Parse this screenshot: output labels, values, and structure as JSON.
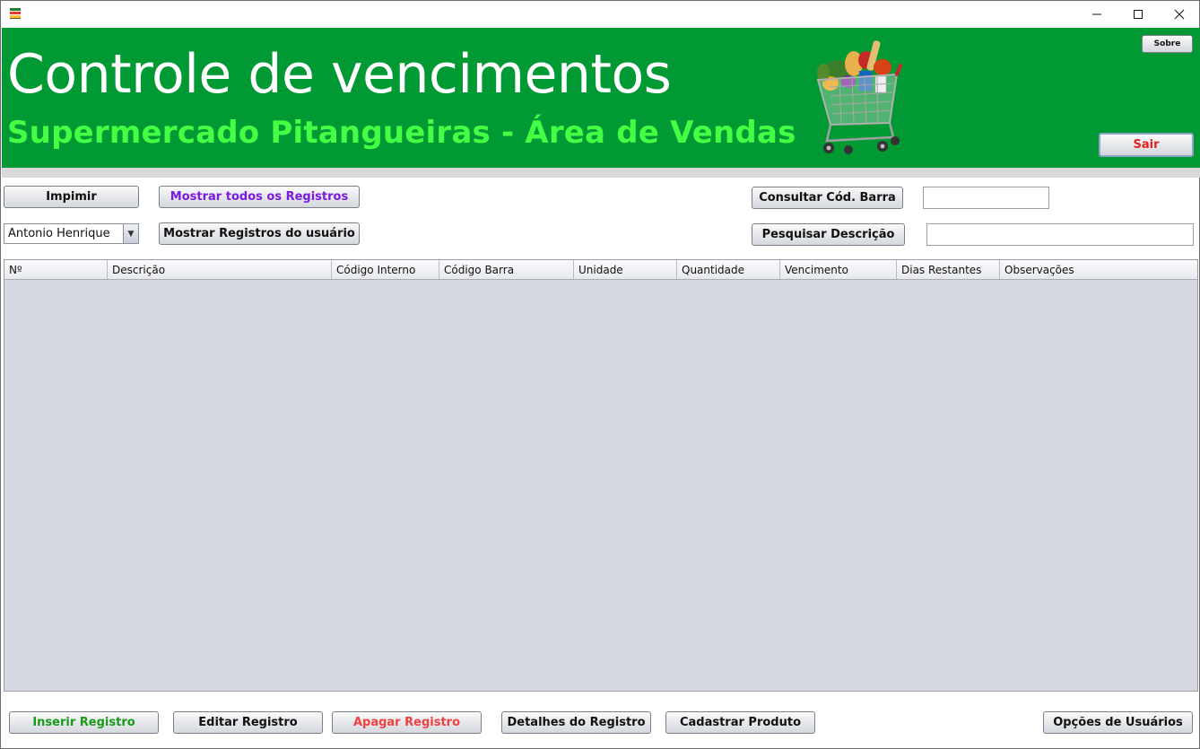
{
  "window": {
    "controls": {
      "minimize": "—",
      "maximize": "☐",
      "close": "✕"
    }
  },
  "banner": {
    "title": "Controle de vencimentos",
    "subtitle": "Supermercado Pitangueiras - Área de Vendas",
    "background": "#009933",
    "subtitle_color": "#44ff44",
    "sobre_label": "Sobre",
    "sair_label": "Sair"
  },
  "toolbar": {
    "imprimir_label": "Impimir",
    "mostrar_todos_label": "Mostrar todos os Registros",
    "mostrar_usuario_label": "Mostrar Registros do usuário",
    "consultar_label": "Consultar Cód. Barra",
    "pesquisar_label": "Pesquisar Descrição",
    "codbarra_value": "",
    "descricao_value": "",
    "user_select": {
      "selected": "Antonio Henrique"
    }
  },
  "table": {
    "columns": [
      "Nº",
      "Descrição",
      "Código Interno",
      "Código Barra",
      "Unidade",
      "Quantidade",
      "Vencimento",
      "Dias Restantes",
      "Observações"
    ],
    "rows": []
  },
  "actions": {
    "inserir_label": "Inserir Registro",
    "editar_label": "Editar Registro",
    "apagar_label": "Apagar Registro",
    "detalhes_label": "Detalhes do Registro",
    "cadastrar_label": "Cadastrar Produto",
    "opcoes_label": "Opções de Usuários"
  },
  "icons": {
    "app": "app-icon",
    "cart": "shopping-cart-icon"
  }
}
